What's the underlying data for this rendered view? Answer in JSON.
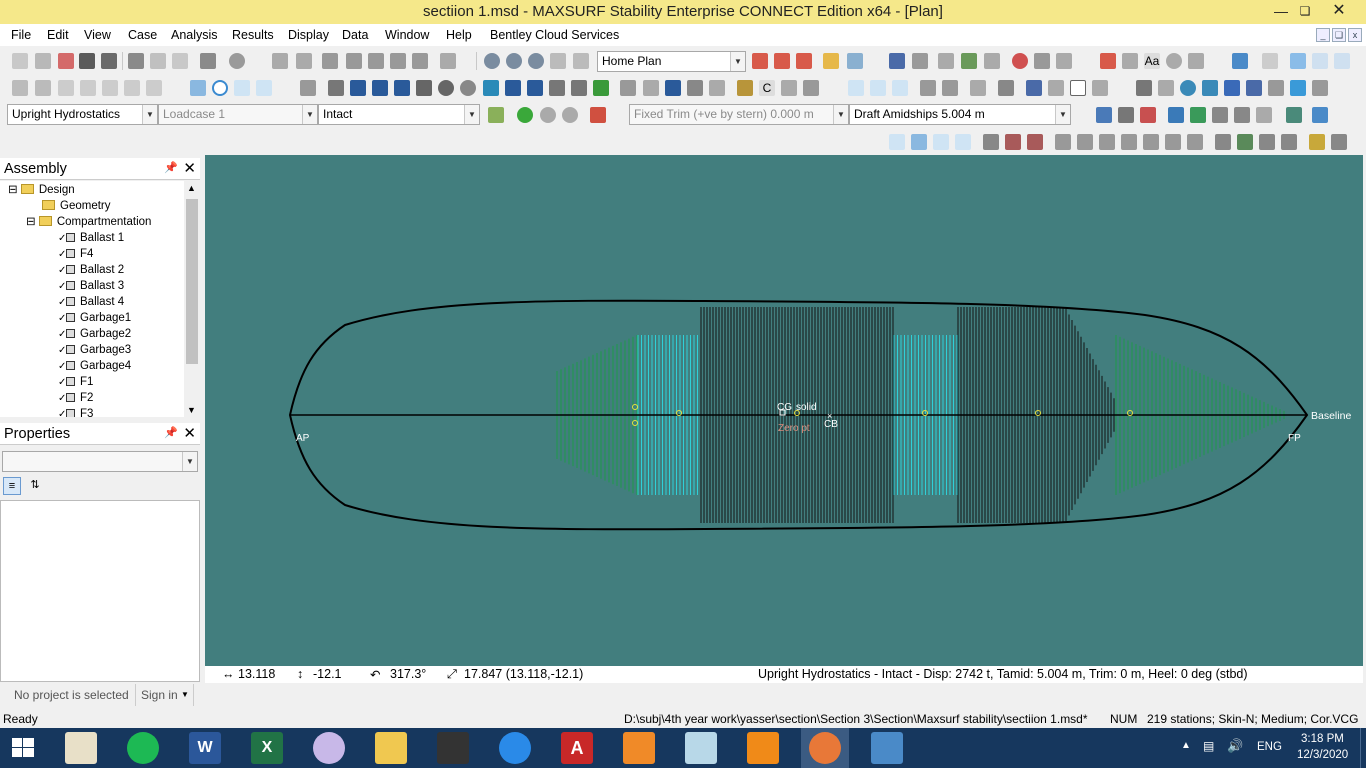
{
  "window": {
    "title": "sectiion 1.msd - MAXSURF Stability Enterprise CONNECT Edition x64 - [Plan]"
  },
  "menu": [
    "File",
    "Edit",
    "View",
    "Case",
    "Analysis",
    "Results",
    "Display",
    "Data",
    "Window",
    "Help",
    "Bentley Cloud Services"
  ],
  "toolbar": {
    "view_select": "Home Plan",
    "analysis_type": "Upright Hydrostatics",
    "loadcase": "Loadcase 1",
    "damage_case": "Intact",
    "fixed_trim": "Fixed Trim (+ve by stern) 0.000 m",
    "draft": "Draft Amidships 5.004 m"
  },
  "assembly": {
    "title": "Assembly",
    "root": "Design",
    "geometry": "Geometry",
    "compartmentation": "Compartmentation",
    "items": [
      "Ballast 1",
      "F4",
      "Ballast 2",
      "Ballast 3",
      "Ballast 4",
      "Garbage1",
      "Garbage2",
      "Garbage3",
      "Garbage4",
      "F1",
      "F2",
      "F3"
    ]
  },
  "properties": {
    "title": "Properties",
    "select_value": ""
  },
  "canvas": {
    "labels": {
      "ap": "AP",
      "fp": "FP",
      "baseline": "Baseline",
      "cg": "CG",
      "solid": "solid",
      "cb": "CB",
      "zero_pt": "Zero pt"
    }
  },
  "coords": {
    "x": "13.118",
    "y": "-12.1",
    "angle": "317.3°",
    "distance": "17.847 (13.118,-12.1)",
    "summary": "Upright Hydrostatics - Intact - Disp: 2742 t, Tamid: 5.004 m, Trim: 0 m, Heel: 0 deg (stbd)"
  },
  "project": {
    "status": "No project is selected",
    "sign_in": "Sign in"
  },
  "status": {
    "ready": "Ready",
    "path": "D:\\subj\\4th year work\\yasser\\section\\Section 3\\Section\\Maxsurf stability\\sectiion 1.msd*",
    "num": "NUM",
    "info": "219 stations; Skin-N; Medium; Cor.VCG"
  },
  "taskbar": {
    "time": "3:18 PM",
    "date": "12/3/2020",
    "lang": "ENG"
  },
  "colors": {
    "viewport_bg": "#427e7e",
    "title_bg": "#f5e88a",
    "tank_green": "#1f9b4a",
    "tank_cyan": "#2fd0d8",
    "hull_line": "#000000"
  }
}
